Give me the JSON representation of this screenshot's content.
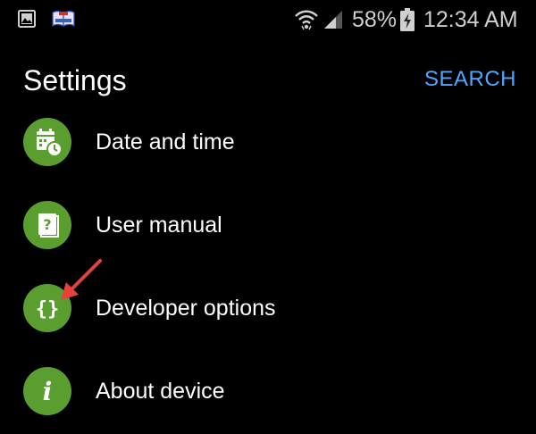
{
  "status_bar": {
    "battery_percent": "58%",
    "time": "12:34 AM"
  },
  "header": {
    "title": "Settings",
    "search_label": "SEARCH"
  },
  "settings": {
    "items": [
      {
        "label": "Date and time",
        "icon": "calendar-clock-icon"
      },
      {
        "label": "User manual",
        "icon": "help-book-icon"
      },
      {
        "label": "Developer options",
        "icon": "curly-braces-icon"
      },
      {
        "label": "About device",
        "icon": "info-icon"
      }
    ]
  },
  "colors": {
    "background": "#000000",
    "icon_circle": "#5a9e2f",
    "accent": "#4fa8ff",
    "annotation_arrow": "#e8413c"
  }
}
